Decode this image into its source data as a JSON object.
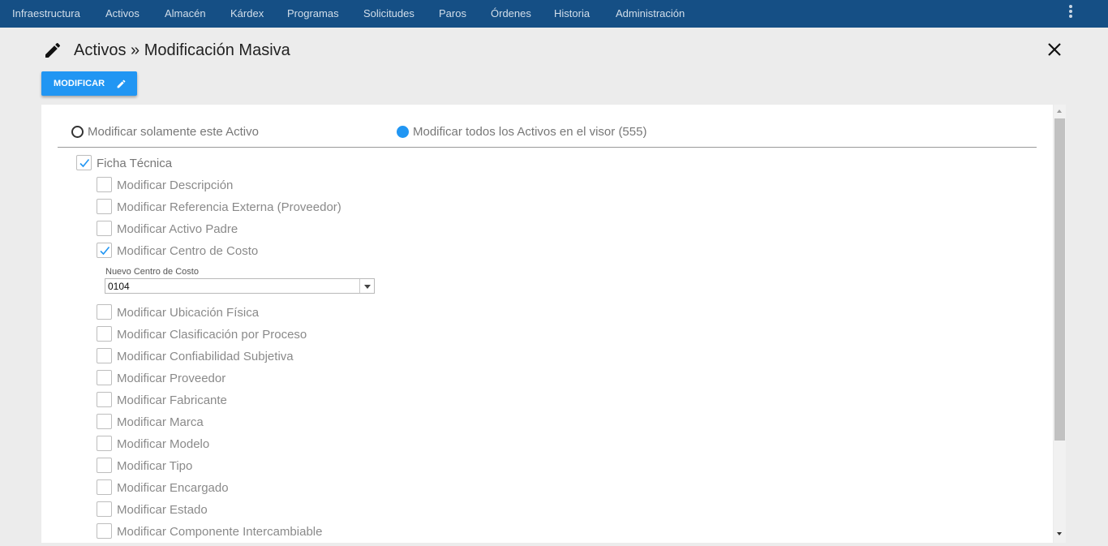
{
  "nav": {
    "items": [
      "Infraestructura",
      "Activos",
      "Almacén",
      "Kárdex",
      "Programas",
      "Solicitudes",
      "Paros",
      "Órdenes",
      "Historia",
      "Administración"
    ],
    "menu_icon": "vertical-dots-icon"
  },
  "header": {
    "title": "Activos » Modificación Masiva",
    "title_icon": "pencil-icon",
    "close_icon": "close-icon"
  },
  "toolbar": {
    "modify_label": "MODIFICAR",
    "modify_icon": "pencil-icon",
    "accent": "#2196f3"
  },
  "scope": {
    "options": [
      {
        "label": "Modificar solamente este Activo",
        "selected": false
      },
      {
        "label": "Modificar todos los Activos en el visor (555)",
        "selected": true
      }
    ]
  },
  "ficha": {
    "label": "Ficha Técnica",
    "checked": true,
    "options": [
      {
        "label": "Modificar Descripción",
        "checked": false
      },
      {
        "label": "Modificar Referencia Externa (Proveedor)",
        "checked": false
      },
      {
        "label": "Modificar Activo Padre",
        "checked": false
      },
      {
        "label": "Modificar Centro de Costo",
        "checked": true
      },
      {
        "label": "Modificar Ubicación Física",
        "checked": false
      },
      {
        "label": "Modificar Clasificación por Proceso",
        "checked": false
      },
      {
        "label": "Modificar Confiabilidad Subjetiva",
        "checked": false
      },
      {
        "label": "Modificar Proveedor",
        "checked": false
      },
      {
        "label": "Modificar Fabricante",
        "checked": false
      },
      {
        "label": "Modificar Marca",
        "checked": false
      },
      {
        "label": "Modificar Modelo",
        "checked": false
      },
      {
        "label": "Modificar Tipo",
        "checked": false
      },
      {
        "label": "Modificar Encargado",
        "checked": false
      },
      {
        "label": "Modificar Estado",
        "checked": false
      },
      {
        "label": "Modificar Componente Intercambiable",
        "checked": false
      }
    ]
  },
  "cost_center": {
    "label": "Nuevo Centro de Costo",
    "value": "0104"
  }
}
